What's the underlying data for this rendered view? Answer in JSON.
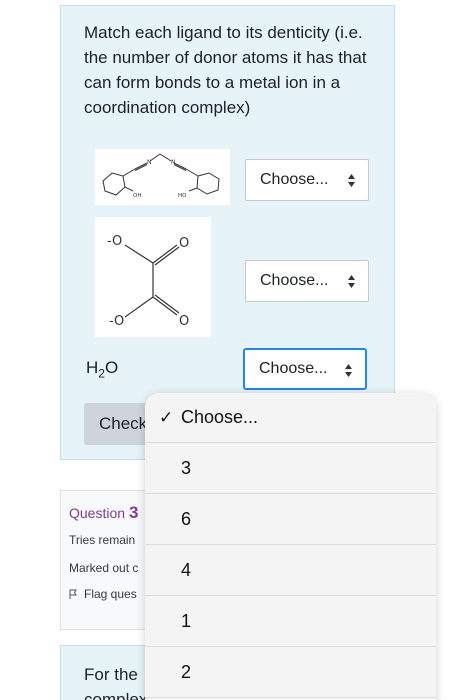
{
  "question": {
    "prompt": "Match each ligand to its denticity (i.e. the number of donor atoms it has that can form bonds to a metal ion in a coordination complex)",
    "ligand3_main": "H",
    "ligand3_sub": "2",
    "ligand3_tail": "O",
    "ligand1_labels": {
      "oh": "OH",
      "ho": "HO",
      "n1": "N",
      "n2": "N"
    },
    "ligand2_labels": {
      "o_top_left": "-O",
      "o_top_right": "O",
      "o_bottom_left": "-O",
      "o_bottom_right": "O"
    },
    "selects": [
      "Choose...",
      "Choose...",
      "Choose..."
    ],
    "check_button": "Check"
  },
  "next_question": {
    "title_prefix": "Question ",
    "title_number": "3",
    "tries": "Tries remain",
    "marked": "Marked out c",
    "flag": "Flag ques",
    "body_line1": "For the",
    "body_line2": "complex"
  },
  "dropdown": {
    "selected": "Choose...",
    "options": [
      "3",
      "6",
      "4",
      "1",
      "2"
    ]
  },
  "colors": {
    "accent": "#1f86f7",
    "card_bg": "#e6f3f8",
    "question_purple": "#7b3e93"
  }
}
